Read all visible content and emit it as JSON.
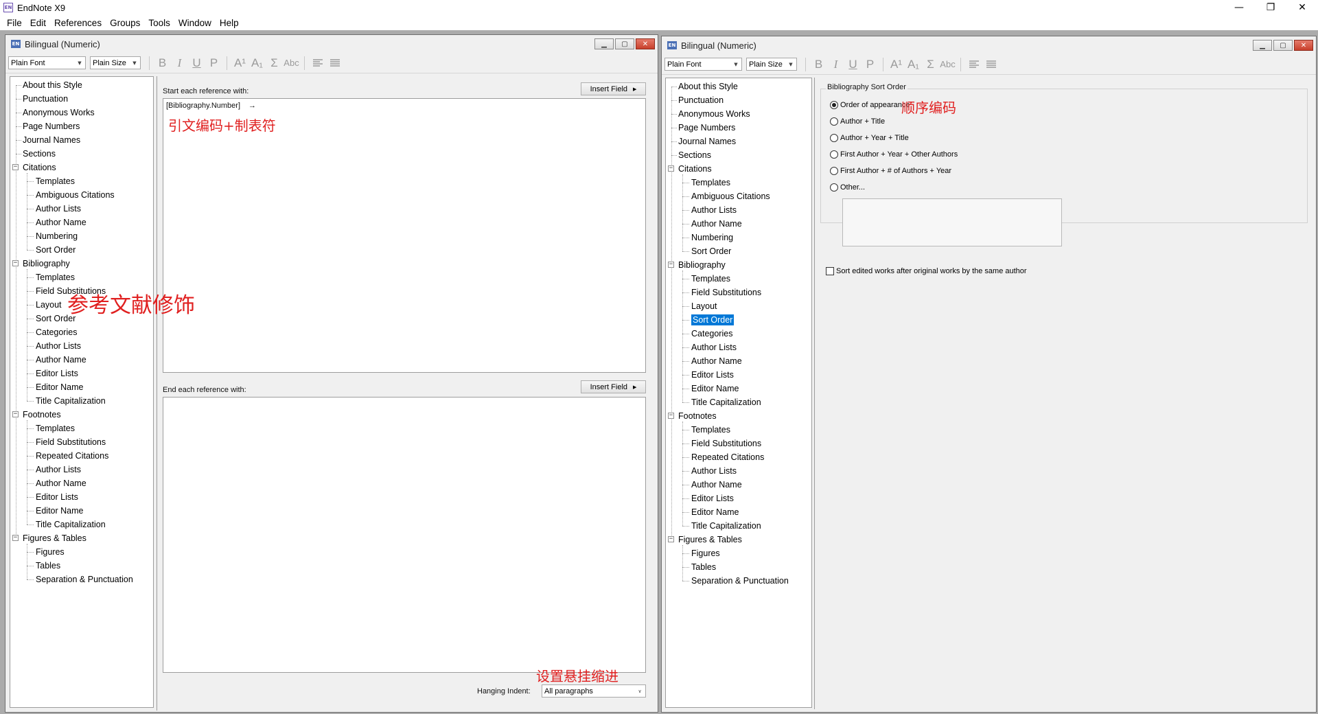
{
  "app": {
    "title": "EndNote X9",
    "icon": "EN",
    "menu": [
      "File",
      "Edit",
      "References",
      "Groups",
      "Tools",
      "Window",
      "Help"
    ]
  },
  "window_controls": {
    "minimize": "—",
    "restore": "❐",
    "close": "✕"
  },
  "toolbar": {
    "font": "Plain Font",
    "size": "Plain Size",
    "bold": "B",
    "italic": "I",
    "underline": "U",
    "plain": "P",
    "superscript": "A¹",
    "subscript": "A₁",
    "symbol": "Σ",
    "smallcaps": "Abc"
  },
  "left_window": {
    "title": "Bilingual (Numeric)",
    "start_label": "Start each reference with:",
    "insert_field": "Insert Field",
    "start_content": "[Bibliography.Number]",
    "tab_mark": "→",
    "end_label": "End each reference with:",
    "hanging_label": "Hanging Indent:",
    "hanging_value": "All paragraphs",
    "annot_start": "引文编码+制表符",
    "annot_layout": "参考文献修饰",
    "annot_hanging": "设置悬挂缩进"
  },
  "right_window": {
    "title": "Bilingual (Numeric)",
    "group_label": "Bibliography Sort Order",
    "options": [
      "Order of appearance",
      "Author + Title",
      "Author + Year + Title",
      "First Author + Year + Other Authors",
      "First Author + # of Authors + Year",
      "Other..."
    ],
    "selected_option": 0,
    "checkbox_label": "Sort edited works after original works by the same author",
    "annot_order": "顺序编码",
    "selected_tree_item": "Sort Order"
  },
  "tree": [
    {
      "label": "About this Style",
      "level": 0
    },
    {
      "label": "Punctuation",
      "level": 0
    },
    {
      "label": "Anonymous Works",
      "level": 0
    },
    {
      "label": "Page Numbers",
      "level": 0
    },
    {
      "label": "Journal Names",
      "level": 0
    },
    {
      "label": "Sections",
      "level": 0
    },
    {
      "label": "Citations",
      "level": 0,
      "expander": true
    },
    {
      "label": "Templates",
      "level": 1
    },
    {
      "label": "Ambiguous Citations",
      "level": 1
    },
    {
      "label": "Author Lists",
      "level": 1
    },
    {
      "label": "Author Name",
      "level": 1
    },
    {
      "label": "Numbering",
      "level": 1
    },
    {
      "label": "Sort Order",
      "level": 1
    },
    {
      "label": "Bibliography",
      "level": 0,
      "expander": true
    },
    {
      "label": "Templates",
      "level": 1
    },
    {
      "label": "Field Substitutions",
      "level": 1
    },
    {
      "label": "Layout",
      "level": 1
    },
    {
      "label": "Sort Order",
      "level": 1
    },
    {
      "label": "Categories",
      "level": 1
    },
    {
      "label": "Author Lists",
      "level": 1
    },
    {
      "label": "Author Name",
      "level": 1
    },
    {
      "label": "Editor Lists",
      "level": 1
    },
    {
      "label": "Editor Name",
      "level": 1
    },
    {
      "label": "Title Capitalization",
      "level": 1
    },
    {
      "label": "Footnotes",
      "level": 0,
      "expander": true
    },
    {
      "label": "Templates",
      "level": 1
    },
    {
      "label": "Field Substitutions",
      "level": 1
    },
    {
      "label": "Repeated Citations",
      "level": 1
    },
    {
      "label": "Author Lists",
      "level": 1
    },
    {
      "label": "Author Name",
      "level": 1
    },
    {
      "label": "Editor Lists",
      "level": 1
    },
    {
      "label": "Editor Name",
      "level": 1
    },
    {
      "label": "Title Capitalization",
      "level": 1
    },
    {
      "label": "Figures & Tables",
      "level": 0,
      "expander": true
    },
    {
      "label": "Figures",
      "level": 1
    },
    {
      "label": "Tables",
      "level": 1
    },
    {
      "label": "Separation & Punctuation",
      "level": 1
    }
  ],
  "colors": {
    "selection": "#0078d7",
    "annotation": "#e02020",
    "panel": "#f0f0f0"
  }
}
